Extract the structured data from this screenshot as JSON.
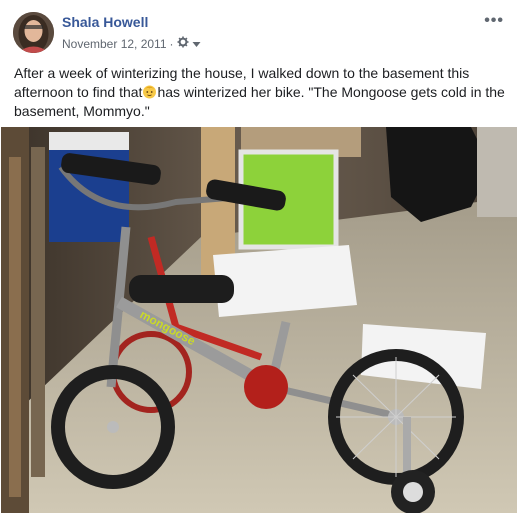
{
  "post": {
    "author": "Shala Howell",
    "date": "November 12, 2011",
    "date_separator": "·",
    "more_label": "•••",
    "text_before_emoji": "After a week of winterizing the house, I walked down to the basement this afternoon to find that",
    "emoji_icon": "baby-face-emoji-icon",
    "text_after_emoji": "has winterized her bike. \"The Mongoose gets cold in the basement, Mommyo.\"",
    "privacy_icon": "gear-icon",
    "audience_dropdown_icon": "chevron-down-icon",
    "photo_bike_brand": "mongoose"
  },
  "colors": {
    "author_link": "#385898",
    "meta_text": "#606770",
    "body_text": "#1c1e21",
    "seat_green": "#8dd23a"
  }
}
